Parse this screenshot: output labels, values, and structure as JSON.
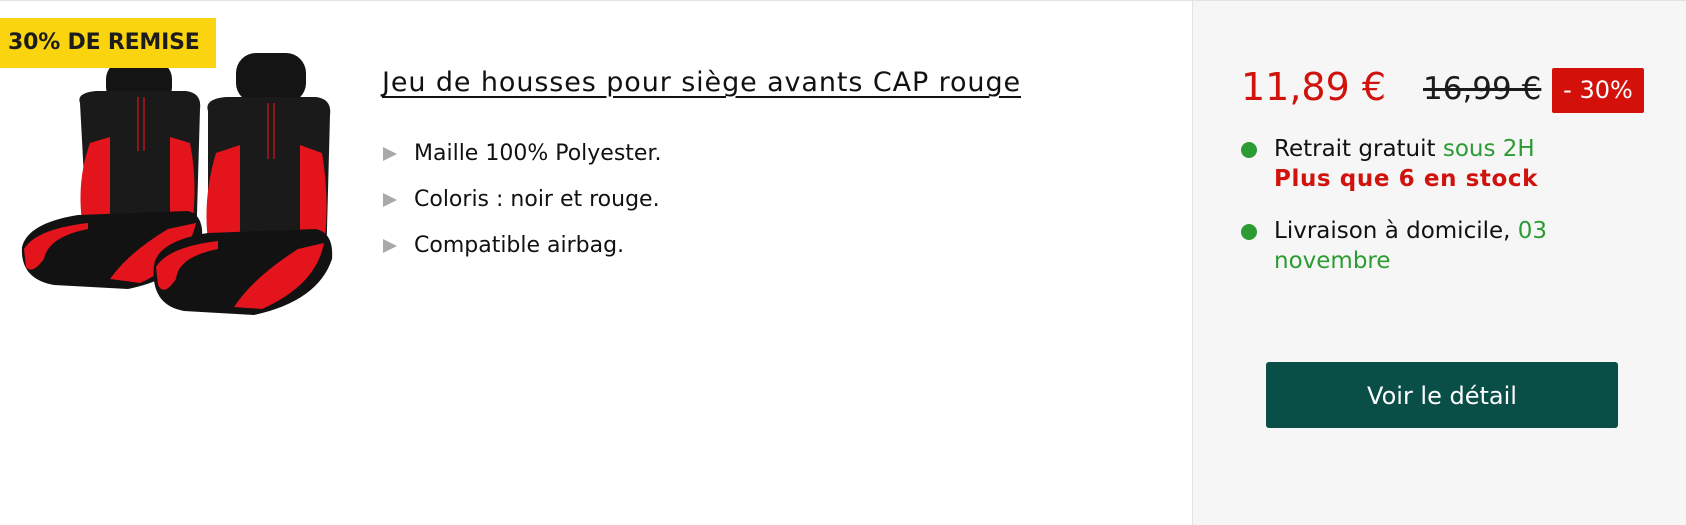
{
  "promo_badge": "30% DE REMISE",
  "product": {
    "title": "Jeu de housses pour siège avants CAP rouge",
    "image_alt": "housses de siège noir et rouge",
    "features": [
      "Maille 100% Polyester.",
      "Coloris : noir et rouge.",
      "Compatible airbag."
    ]
  },
  "pricing": {
    "price": "11,89 €",
    "old_price": "16,99 €",
    "discount": "- 30%"
  },
  "availability": {
    "pickup_label": "Retrait gratuit ",
    "pickup_time": "sous 2H",
    "stock_text": "Plus que 6 en stock",
    "delivery_label": "Livraison à domicile, ",
    "delivery_date": "03 novembre"
  },
  "cta_label": "Voir le détail",
  "colors": {
    "badge_yellow": "#f9d40f",
    "price_red": "#d1130d",
    "available_green": "#2d9b33",
    "cta_green": "#0a4f47",
    "side_panel_bg": "#f6f6f6"
  },
  "icons": {
    "feature_bullet": "triangle-right-icon",
    "availability_dot": "status-dot-icon"
  }
}
